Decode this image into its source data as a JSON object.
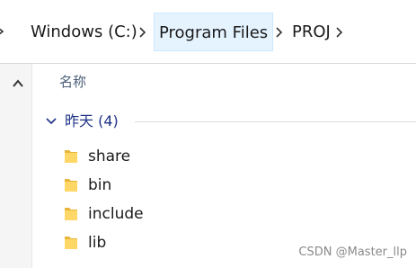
{
  "address_bar": {
    "crumbs": [
      "Windows (C:)",
      "Program Files",
      "PROJ"
    ],
    "separator_icon": "chevron-right-icon"
  },
  "sidebar": {
    "scroll_up_icon": "chevron-up-icon"
  },
  "file_list": {
    "column_header": "名称",
    "group": {
      "label": "昨天 (4)",
      "expanded": true
    },
    "items": [
      {
        "name": "share",
        "icon": "folder-icon"
      },
      {
        "name": "bin",
        "icon": "folder-icon"
      },
      {
        "name": "include",
        "icon": "folder-icon"
      },
      {
        "name": "lib",
        "icon": "folder-icon"
      }
    ]
  },
  "watermark": "CSDN @Master_llp",
  "colors": {
    "highlight_bg": "#e5f3ff",
    "group_label": "#1e3287",
    "folder_yellow": "#ffd766",
    "header_text": "#4c607a"
  }
}
